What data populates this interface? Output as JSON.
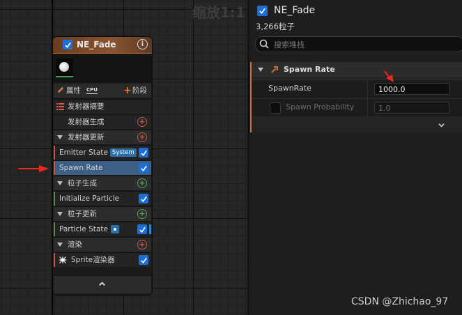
{
  "graph": {
    "zoom_label": "缩放1:1"
  },
  "node": {
    "title": "NE_Fade",
    "enabled": true,
    "properties_label": "属性",
    "cpu_label": "CPU",
    "stage_label": "阶段",
    "emitter_summary_label": "发射器摘要",
    "rows": {
      "emitter_spawn": "发射器生成",
      "emitter_update": "发射器更新",
      "emitter_state": "Emitter State",
      "emitter_state_tag": "System",
      "spawn_rate": "Spawn Rate",
      "particle_spawn": "粒子生成",
      "initialize_particle": "Initialize Particle",
      "particle_update": "粒子更新",
      "particle_state": "Particle State",
      "render": "渲染",
      "sprite_renderer": "Sprite渲染器"
    }
  },
  "panel": {
    "title": "NE_Fade",
    "particle_count": "3,266粒子",
    "search_placeholder": "搜索堆栈",
    "section_title": "Spawn Rate",
    "properties": [
      {
        "label": "SpawnRate",
        "value": "1000.0",
        "enabled": true
      },
      {
        "label": "Spawn Probability",
        "value": "1.0",
        "enabled": false
      }
    ]
  },
  "watermark": "CSDN @Zhichao_97",
  "colors": {
    "accent_blue": "#1d6fd6",
    "node_header": "#8a5430",
    "selected_row": "#3d5f86",
    "arrow_red": "#e8281e"
  }
}
